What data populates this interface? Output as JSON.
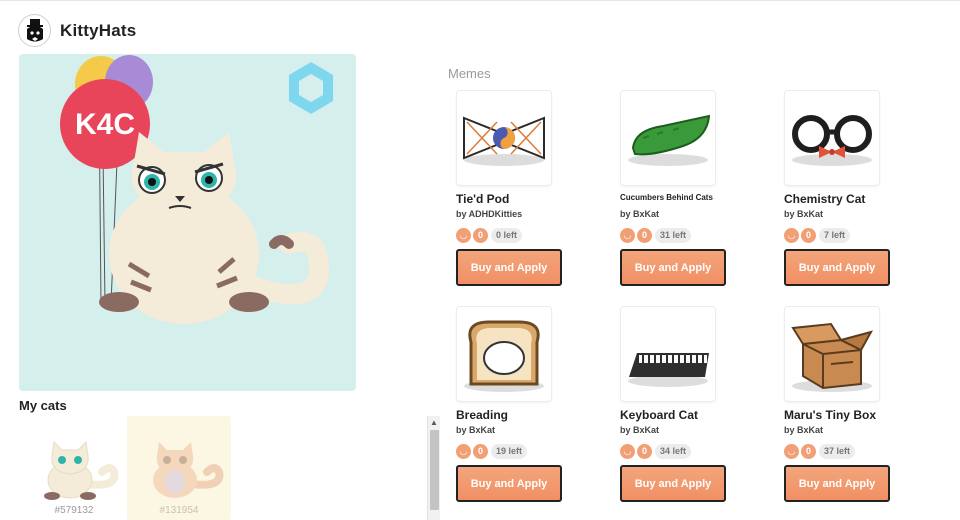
{
  "app": {
    "title": "KittyHats"
  },
  "preview": {
    "balloon_text": "K4C"
  },
  "my_cats": {
    "title": "My cats",
    "cats": [
      {
        "id": "#579132"
      },
      {
        "id": "#131954"
      }
    ]
  },
  "memes": {
    "title": "Memes",
    "buy_label": "Buy and Apply",
    "items": [
      {
        "name": "Tie'd Pod",
        "by": "by ADHDKitties",
        "a": "0",
        "left": "0 left"
      },
      {
        "name": "Cucumbers Behind Cats",
        "by": "by BxKat",
        "a": "0",
        "left": "31 left"
      },
      {
        "name": "Chemistry Cat",
        "by": "by BxKat",
        "a": "0",
        "left": "7 left"
      },
      {
        "name": "Breading",
        "by": "by BxKat",
        "a": "0",
        "left": "19 left"
      },
      {
        "name": "Keyboard Cat",
        "by": "by BxKat",
        "a": "0",
        "left": "34 left"
      },
      {
        "name": "Maru's Tiny Box",
        "by": "by BxKat",
        "a": "0",
        "left": "37 left"
      }
    ]
  },
  "colors": {
    "accent": "#f19f75",
    "preview_bg": "#d5efec"
  }
}
